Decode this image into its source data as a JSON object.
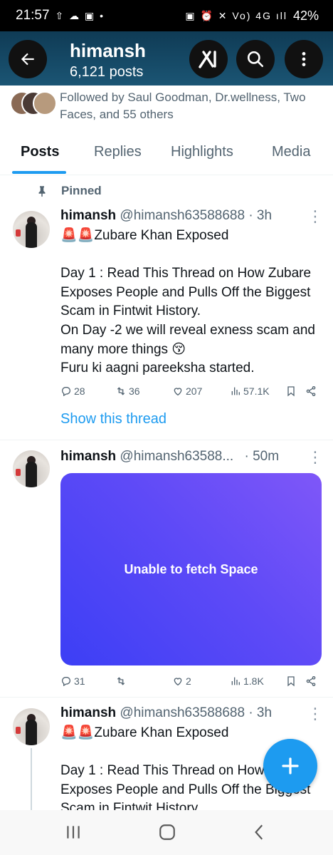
{
  "status_bar": {
    "time": "21:57",
    "left_icons": "⇧ ☁ ▣ •",
    "right_icons": "▣ ⏰ ✕ Vo) 4G ıll",
    "battery": "42%"
  },
  "header": {
    "title": "himansh",
    "subtitle": "6,121 posts"
  },
  "followed_by": {
    "text": "Followed by Saul Goodman, Dr.wellness, Two Faces, and 55 others"
  },
  "tabs": [
    {
      "label": "Posts"
    },
    {
      "label": "Replies"
    },
    {
      "label": "Highlights"
    },
    {
      "label": "Media"
    }
  ],
  "pinned_label": "Pinned",
  "tweets": [
    {
      "name": "himansh",
      "handle": "@himansh63588688",
      "time": "· 3h",
      "text": "🚨🚨Zubare Khan Exposed\n\nDay 1 : Read This Thread on How Zubare Exposes People and Pulls Off the Biggest Scam in Fintwit History.\nOn Day -2 we will reveal exness scam and many more things 😚\nFuru ki aagni pareeksha started.",
      "replies": "28",
      "reposts": "36",
      "likes": "207",
      "views": "57.1K",
      "show_thread": "Show this thread"
    },
    {
      "name": "himansh",
      "handle": "@himansh63588...",
      "time": "· 50m",
      "card_text": "Unable to fetch Space",
      "replies": "31",
      "reposts": "",
      "likes": "2",
      "views": "1.8K"
    },
    {
      "name": "himansh",
      "handle": "@himansh63588688",
      "time": "· 3h",
      "text": "🚨🚨Zubare Khan Exposed\n\nDay 1 : Read This Thread on How Zubare Exposes People and Pulls Off the Biggest Scam in Fintwit History"
    }
  ],
  "colors": {
    "accent": "#1d9bf0",
    "header_bg": "#15455f",
    "muted_text": "#536471"
  }
}
